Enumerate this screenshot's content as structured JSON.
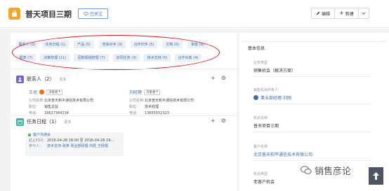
{
  "header": {
    "title": "普天项目三期",
    "follow_label": "已关注",
    "edit_label": "编辑",
    "new_label": "新建"
  },
  "tabs": [
    "联系人 (2)",
    "任务日程 (1)",
    "产品 (5)",
    "竞争对手 (3)",
    "合作伙伴 (5)",
    "文档 (5)",
    "审批 (6)",
    "报表 (7)",
    "决策管理 (11)",
    "回款报销管理 (7)",
    "协同任务 (3)",
    "技术支持 (5)",
    "合作对象 (4)"
  ],
  "contacts_section": {
    "title": "联系人（2）",
    "more": "更多",
    "contacts": [
      {
        "name": "王总",
        "role": "决策者",
        "fields": [
          {
            "k": "公司名称:",
            "v": "北京普天和平通信技术有限公司"
          },
          {
            "k": "职位:",
            "v": "销售总监"
          },
          {
            "k": "电话:",
            "v": "18627364234"
          }
        ]
      },
      {
        "name": "刘经理",
        "role": "决策者",
        "fields": [
          {
            "k": "公司名称:",
            "v": "北京普天和平通信技术有限公司"
          },
          {
            "k": "职位:",
            "v": "技术经理"
          },
          {
            "k": "电话:",
            "v": "13655552323"
          }
        ]
      }
    ]
  },
  "task_section": {
    "title": "任务日程（1）",
    "more": "更多",
    "task": {
      "name": "客户沟通会",
      "time_label": "起止时间：",
      "time_value": "2016-04-28 18:00 至 2016-04-28 19:...",
      "people_label": "参与人：",
      "people_value": "技术支持-张英 事业部经理-刘胜 王经理"
    }
  },
  "side": {
    "title": "基本信息",
    "fields": [
      {
        "label": "业务类型",
        "value": "销售机会（解决方案）",
        "link": false
      },
      {
        "label": "销售机会所有人",
        "value": "事业部经理-刘刚",
        "link": true
      },
      {
        "label": "机会名称",
        "value": "普天项目三期",
        "link": false
      },
      {
        "label": "客户名称",
        "value": "北京普天和平通信技术有限公司",
        "link": true
      },
      {
        "label": "机会类型",
        "value": "老客户机会",
        "link": false
      }
    ]
  },
  "watermark": "销售彦论",
  "colors": {
    "brand": "#f5a623",
    "link": "#3e6eb2",
    "highlight": "#d9141b"
  }
}
